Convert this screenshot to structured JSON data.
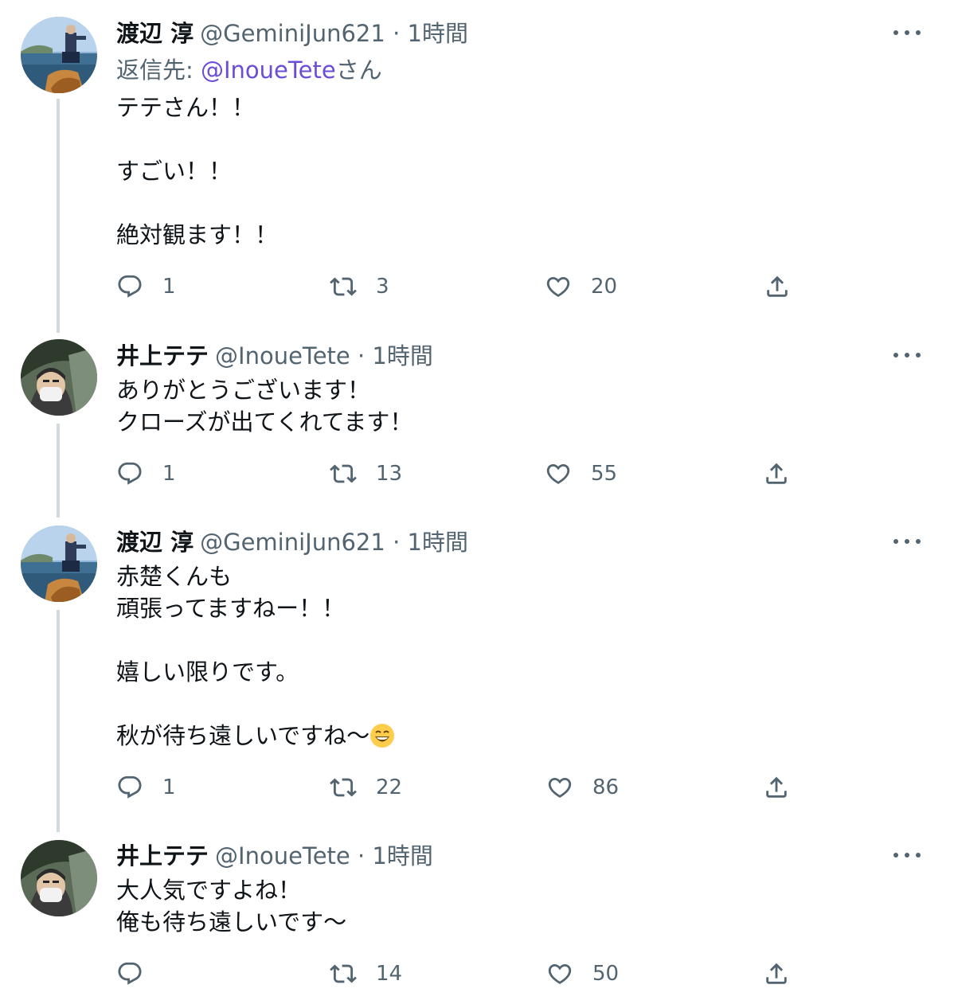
{
  "tweets": [
    {
      "name": "渡辺 淳",
      "handle": "@GeminiJun621",
      "time": "1時間",
      "separator": "·",
      "reply_prefix": "返信先: ",
      "reply_mention": "@InoueTete",
      "reply_suffix": "さん",
      "body": "テテさん！！\n\nすごい！！\n\n絶対観ます！！",
      "replies": "1",
      "retweets": "3",
      "likes": "20",
      "avatar": "avatar-seaside-photo"
    },
    {
      "name": "井上テテ",
      "handle": "@InoueTete",
      "time": "1時間",
      "separator": "·",
      "body": "ありがとうございます！\nクローズが出てくれてます！",
      "replies": "1",
      "retweets": "13",
      "likes": "55",
      "avatar": "avatar-masked-person-photo"
    },
    {
      "name": "渡辺 淳",
      "handle": "@GeminiJun621",
      "time": "1時間",
      "separator": "·",
      "body_lines": [
        "赤楚くんも",
        "頑張ってますねー！！",
        "",
        "嬉しい限りです。",
        "",
        "秋が待ち遠しいですね〜"
      ],
      "emoji": "grinning-face-emoji",
      "replies": "1",
      "retweets": "22",
      "likes": "86",
      "avatar": "avatar-seaside-photo"
    },
    {
      "name": "井上テテ",
      "handle": "@InoueTete",
      "time": "1時間",
      "separator": "·",
      "body": "大人気ですよね！\n俺も待ち遠しいです〜",
      "replies": "",
      "retweets": "14",
      "likes": "50",
      "avatar": "avatar-masked-person-photo"
    }
  ],
  "icons": {
    "reply": "reply-icon",
    "retweet": "retweet-icon",
    "like": "heart-icon",
    "share": "share-icon",
    "more": "more-icon"
  },
  "colors": {
    "text": "#0f1419",
    "secondary": "#536471",
    "mention": "#6a4dd6",
    "thread_line": "#cfd9de"
  }
}
